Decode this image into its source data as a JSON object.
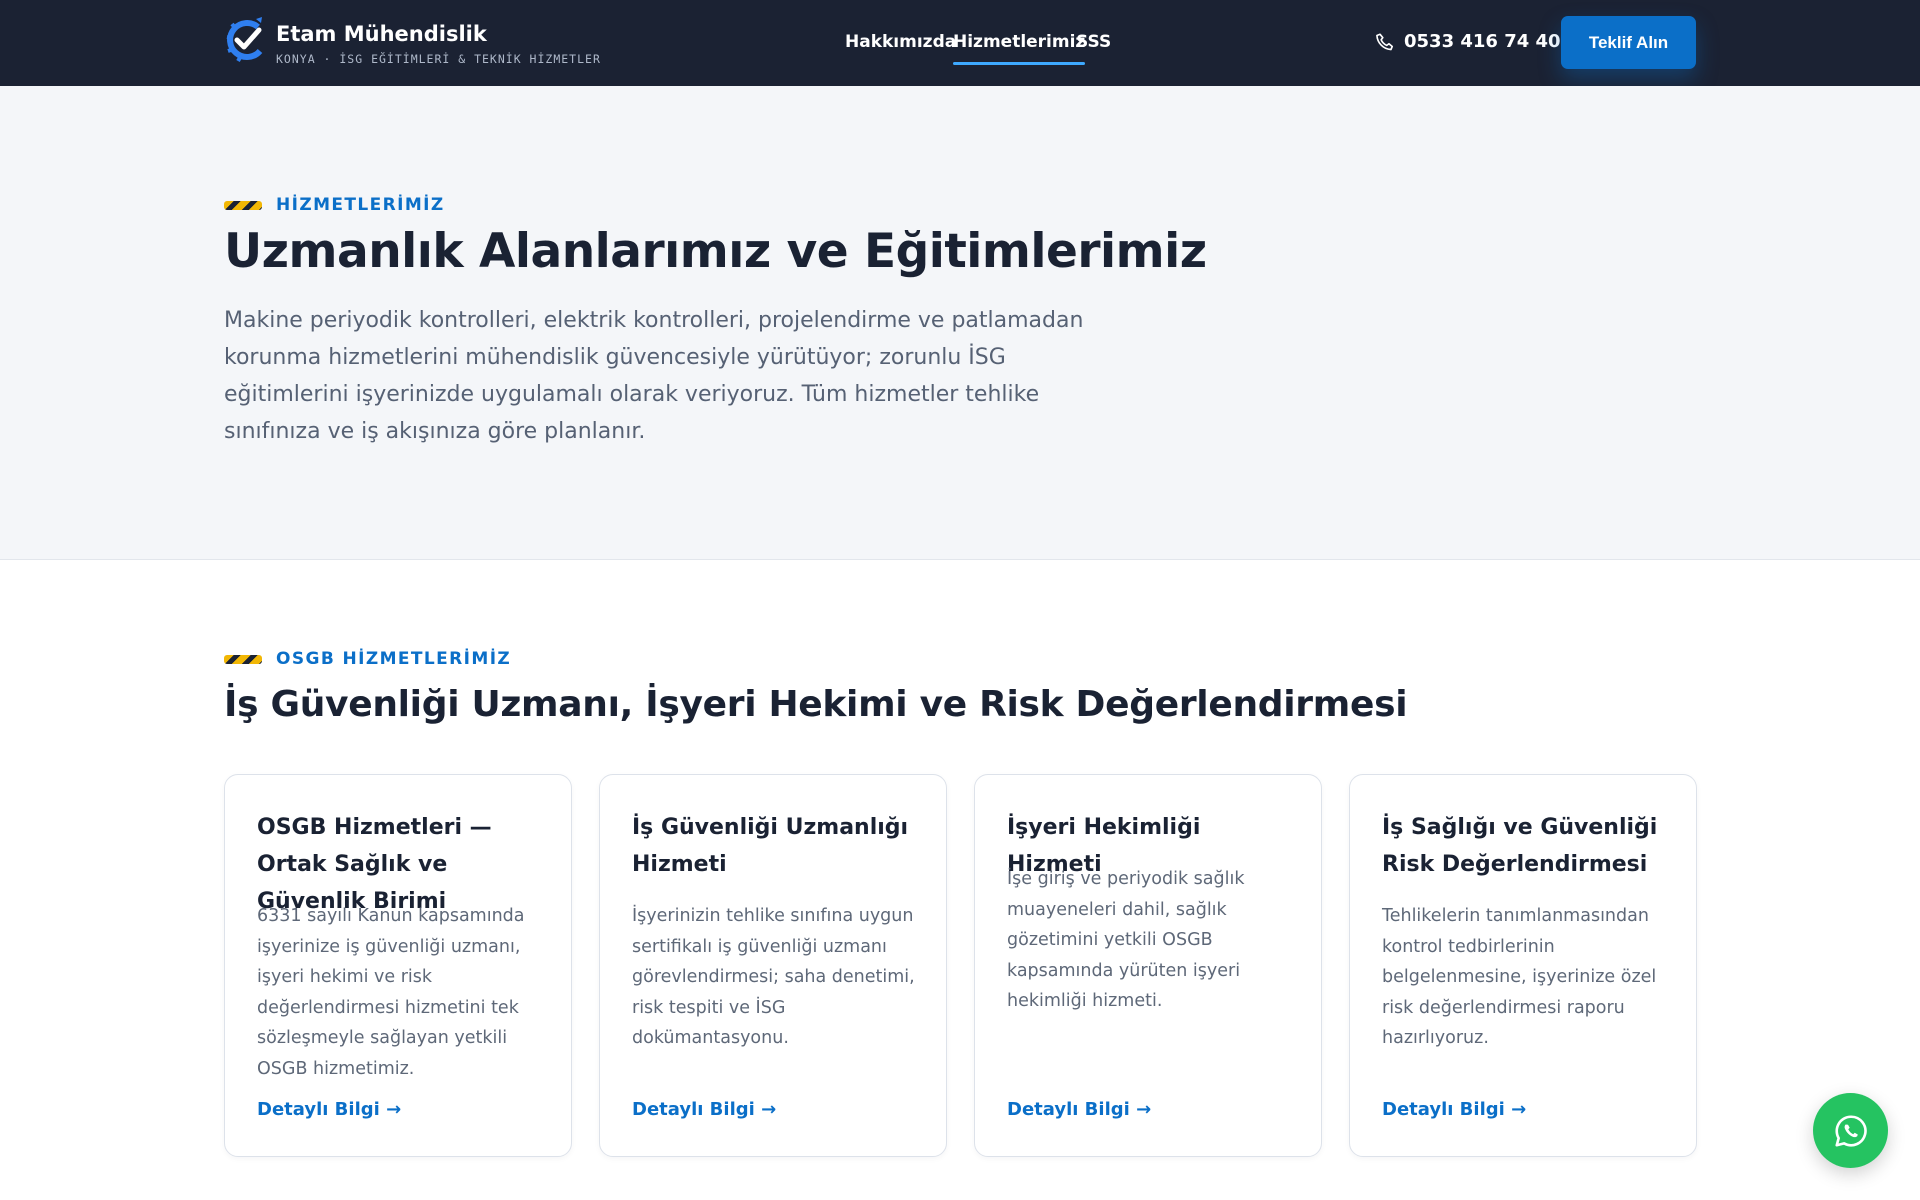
{
  "brand": {
    "name": "Etam Mühendislik",
    "tagline": "KONYA · İSG EĞİTİMLERİ & TEKNİK HİZMETLER"
  },
  "nav": {
    "items": [
      {
        "label": "Hakkımızda"
      },
      {
        "label": "Hizmetlerimiz",
        "active": true
      },
      {
        "label": "SSS"
      }
    ],
    "phone": "0533 416 74 40",
    "cta": "Teklif Alın"
  },
  "hero": {
    "eyebrow": "HİZMETLERİMİZ",
    "title": "Uzmanlık Alanlarımız ve Eğitimlerimiz",
    "description": "Makine periyodik kontrolleri, elektrik kontrolleri, projelendirme ve patlamadan korunma hizmetlerini mühendislik güvencesiyle yürütüyor; zorunlu İSG eğitimlerini işyerinizde uygulamalı olarak veriyoruz. Tüm hizmetler tehlike sınıfınıza ve iş akışınıza göre planlanır."
  },
  "services": {
    "eyebrow": "OSGB HİZMETLERİMİZ",
    "title": "İş Güvenliği Uzmanı, İşyeri Hekimi ve Risk Değerlendirmesi",
    "cards": [
      {
        "title": "OSGB Hizmetleri — Ortak Sağlık ve Güvenlik Birimi",
        "description": "6331 sayılı Kanun kapsamında işyerinize iş güvenliği uzmanı, işyeri hekimi ve risk değerlendirmesi hizmetini tek sözleşmeyle sağlayan yetkili OSGB hizmetimiz.",
        "link": "Detaylı Bilgi →"
      },
      {
        "title": "İş Güvenliği Uzmanlığı Hizmeti",
        "description": "İşyerinizin tehlike sınıfına uygun sertifikalı iş güvenliği uzmanı görevlendirmesi; saha denetimi, risk tespiti ve İSG dokümantasyonu.",
        "link": "Detaylı Bilgi →"
      },
      {
        "title": "İşyeri Hekimliği Hizmeti",
        "description": "İşe giriş ve periyodik sağlık muayeneleri dahil, sağlık gözetimini yetkili OSGB kapsamında yürüten işyeri hekimliği hizmeti.",
        "link": "Detaylı Bilgi →"
      },
      {
        "title": "İş Sağlığı ve Güvenliği Risk Değerlendirmesi",
        "description": "Tehlikelerin tanımlanmasından kontrol tedbirlerinin belgelenmesine, işyerinize özel risk değerlendirmesi raporu hazırlıyoruz.",
        "link": "Detaylı Bilgi →"
      }
    ]
  },
  "icons": {
    "logo": "gear-check-logo-icon",
    "phone": "phone-icon",
    "whatsapp": "whatsapp-icon"
  },
  "colors": {
    "header_bg": "#1b2233",
    "accent_blue": "#0b6fc8",
    "nav_underline": "#3ea9ff",
    "stripe_yellow": "#f2b705",
    "whatsapp_green": "#25c361"
  }
}
